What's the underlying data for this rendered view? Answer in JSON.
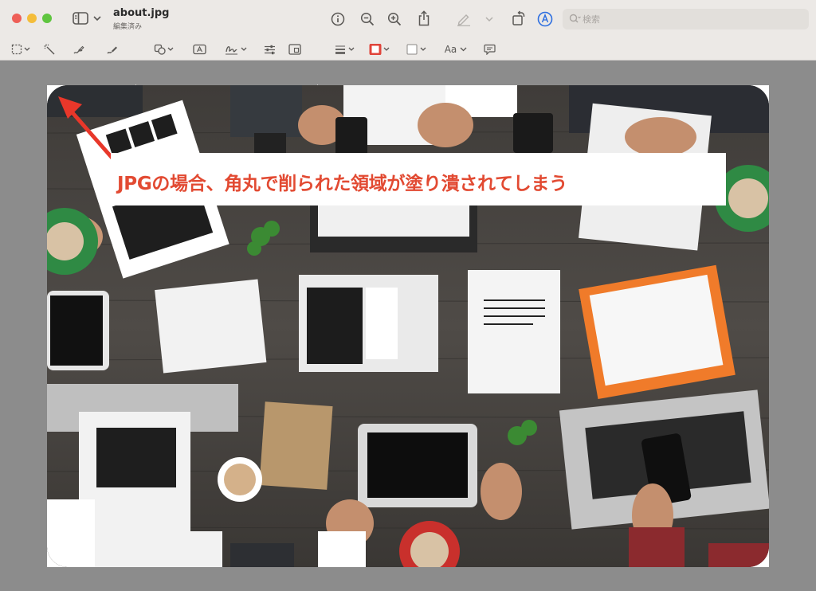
{
  "window": {
    "file_name": "about.jpg",
    "status": "編集済み"
  },
  "search": {
    "placeholder": "検索"
  },
  "toolbar": {
    "font_button_label": "Aa"
  },
  "annotation": {
    "text": "JPGの場合、角丸で削られた領域が塗り潰されてしまう",
    "color": "#e24a32"
  },
  "icons": {
    "sidebar": "sidebar-icon",
    "info": "info-icon",
    "zoom_out": "zoom-out-icon",
    "zoom_in": "zoom-in-icon",
    "share": "share-icon",
    "markup": "pen-icon",
    "rotate": "rotate-icon",
    "markup_circle": "markup-icon",
    "search": "search-icon"
  },
  "photo": {
    "overview_note": "stock photo of a business meeting, people with laptops and papers on a dark table"
  }
}
